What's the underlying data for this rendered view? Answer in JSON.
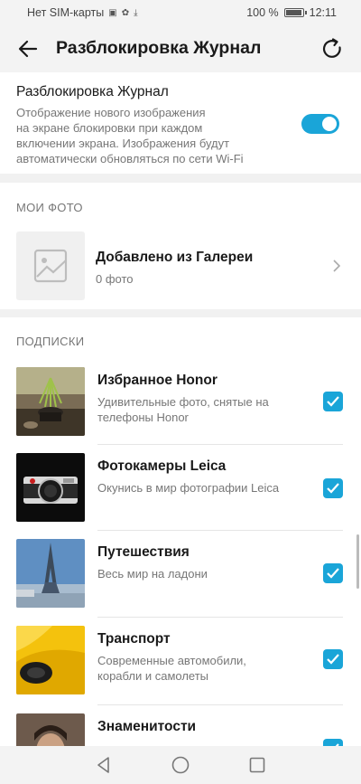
{
  "status_bar": {
    "carrier": "Нет SIM-карты",
    "battery": "100 %",
    "battery_level": 1.0,
    "time": "12:11"
  },
  "app_bar": {
    "title": "Разблокировка Журнал",
    "back_icon": "arrow-left-icon",
    "refresh_icon": "refresh-icon"
  },
  "unlock_section": {
    "title": "Разблокировка Журнал",
    "description_lines": [
      "Отображение нового изображения",
      "на экране блокировки при каждом",
      "включении экрана. Изображения будут",
      "автоматически обновляться по сети Wi-Fi"
    ],
    "toggle_on": true
  },
  "my_photos": {
    "header": "МОИ ФОТО",
    "gallery_title": "Добавлено из Галереи",
    "gallery_count": "0 фото",
    "gallery_icon": "image-placeholder-icon"
  },
  "subscriptions": {
    "header": "ПОДПИСКИ",
    "items": [
      {
        "title": "Избранное Honor",
        "desc_lines": [
          "Удивительные фото, снятые на",
          "телефоны Honor"
        ],
        "checked": true,
        "thumb": "honor-thumbnail"
      },
      {
        "title": "Фотокамеры Leica",
        "desc_lines": [
          "Окунись в мир фотографии Leica"
        ],
        "checked": true,
        "thumb": "leica-camera-thumbnail"
      },
      {
        "title": "Путешествия",
        "desc_lines": [
          "Весь мир на ладони"
        ],
        "checked": true,
        "thumb": "eiffel-tower-thumbnail"
      },
      {
        "title": "Транспорт",
        "desc_lines": [
          "Современные автомобили,",
          "корабли и самолеты"
        ],
        "checked": true,
        "thumb": "sports-car-thumbnail"
      },
      {
        "title": "Знаменитости",
        "desc_lines": [],
        "checked": true,
        "thumb": "celebrity-thumbnail"
      }
    ]
  },
  "colors": {
    "accent": "#1aa5d8",
    "background": "#f1f1f1",
    "card": "#ffffff"
  },
  "nav_bar": {
    "back_icon": "nav-back-triangle-icon",
    "home_icon": "nav-home-circle-icon",
    "recents_icon": "nav-recents-square-icon"
  }
}
